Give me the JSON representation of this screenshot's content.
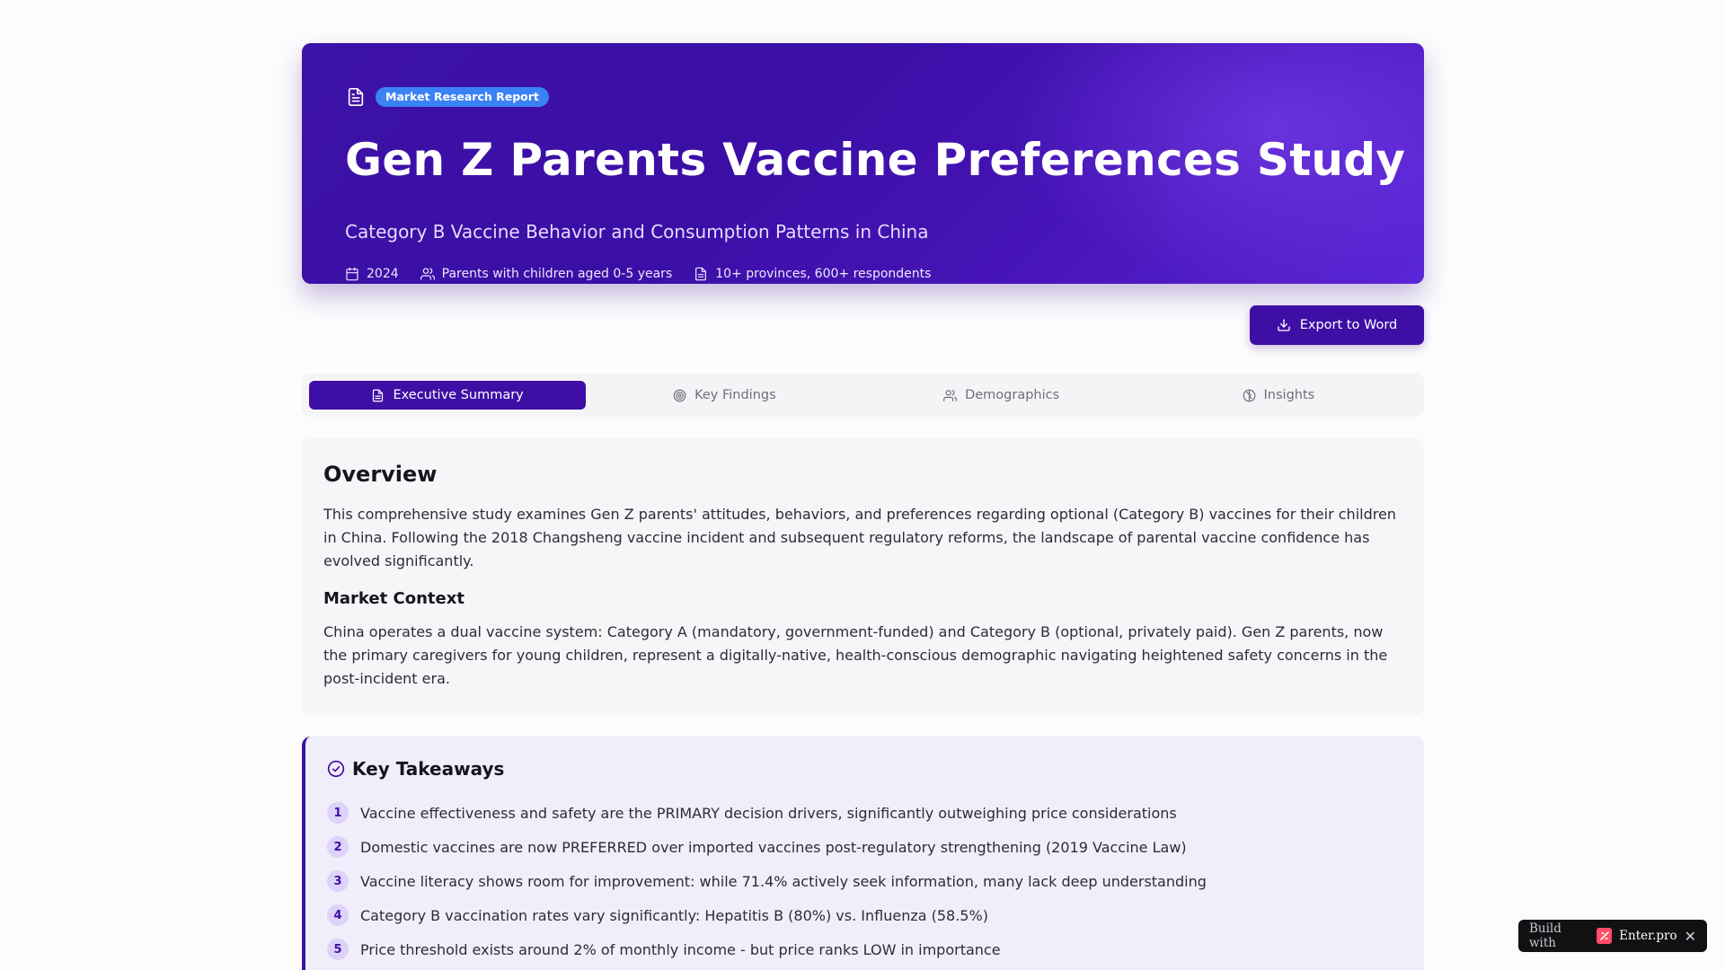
{
  "header": {
    "badge": "Market Research Report",
    "title": "Gen Z Parents Vaccine Preferences Study",
    "subtitle": "Category B Vaccine Behavior and Consumption Patterns in China",
    "meta": {
      "year": "2024",
      "audience": "Parents with children aged 0-5 years",
      "sample": "10+ provinces, 600+ respondents"
    }
  },
  "toolbar": {
    "export_label": "Export to Word"
  },
  "tabs": [
    {
      "label": "Executive Summary",
      "icon": "document-icon",
      "active": true
    },
    {
      "label": "Key Findings",
      "icon": "target-icon",
      "active": false
    },
    {
      "label": "Demographics",
      "icon": "users-icon",
      "active": false
    },
    {
      "label": "Insights",
      "icon": "brain-icon",
      "active": false
    }
  ],
  "overview": {
    "title": "Overview",
    "paragraph": "This comprehensive study examines Gen Z parents' attitudes, behaviors, and preferences regarding optional (Category B) vaccines for their children in China. Following the 2018 Changsheng vaccine incident and subsequent regulatory reforms, the landscape of parental vaccine confidence has evolved significantly.",
    "context_title": "Market Context",
    "context_paragraph": "China operates a dual vaccine system: Category A (mandatory, government-funded) and Category B (optional, privately paid). Gen Z parents, now the primary caregivers for young children, represent a digitally-native, health-conscious demographic navigating heightened safety concerns in the post-incident era."
  },
  "takeaways": {
    "title": "Key Takeaways",
    "items": [
      {
        "n": "1",
        "text": "Vaccine effectiveness and safety are the PRIMARY decision drivers, significantly outweighing price considerations"
      },
      {
        "n": "2",
        "text": "Domestic vaccines are now PREFERRED over imported vaccines post-regulatory strengthening (2019 Vaccine Law)"
      },
      {
        "n": "3",
        "text": "Vaccine literacy shows room for improvement: while 71.4% actively seek information, many lack deep understanding"
      },
      {
        "n": "4",
        "text": "Category B vaccination rates vary significantly: Hepatitis B (80%) vs. Influenza (58.5%)"
      },
      {
        "n": "5",
        "text": "Price threshold exists around 2% of monthly income - but price ranks LOW in importance"
      }
    ]
  },
  "build_badge": {
    "label": "Build with",
    "brand": "Enter.pro",
    "close": "✕"
  },
  "colors": {
    "primary": "#3d0fa5",
    "badge_blue": "#3b82f6",
    "takeaway_bg": "#f1eefb"
  }
}
